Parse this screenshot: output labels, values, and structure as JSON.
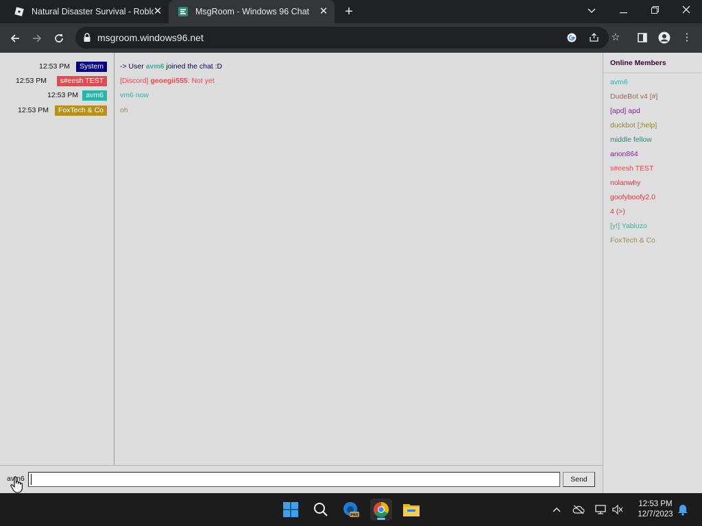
{
  "browser": {
    "tabs": [
      {
        "title": "Natural Disaster Survival - Roblox",
        "icon": "roblox-icon"
      },
      {
        "title": "MsgRoom - Windows 96 Chat",
        "icon": "windows96-icon"
      }
    ],
    "url": "msgroom.windows96.net"
  },
  "chat": {
    "messages": [
      {
        "time": "12:53 PM",
        "user": "System",
        "user_color": "#000080",
        "pre": "-> User ",
        "bold": "avm6",
        "post": " joined the chat :D",
        "text_color": "#000080",
        "bold_color": "#2ab3a8"
      },
      {
        "time": "12:53 PM",
        "user": "s#eesh TEST",
        "user_color": "#e8474e",
        "pre": "[Discord] ",
        "bold": "geoegii555",
        "post": ": Not yet",
        "text_color": "#e8474e",
        "bold_color": "#e8474e"
      },
      {
        "time": "12:53 PM",
        "user": "avm6",
        "user_color": "#2ab3a8",
        "pre": "vm6 now",
        "bold": "",
        "post": "",
        "text_color": "#2ab3a8",
        "bold_color": "#2ab3a8"
      },
      {
        "time": "12:53 PM",
        "user": "FoxTech & Co",
        "user_color": "#b8911c",
        "pre": "oh",
        "bold": "",
        "post": "",
        "text_color": "#a08a3a",
        "bold_color": "#a08a3a"
      }
    ],
    "online_header": "Online Members",
    "members": [
      {
        "name": "avm6",
        "color": "#2ab3a8"
      },
      {
        "name": "DudeBot v4 [#]",
        "color": "#a0635a"
      },
      {
        "name": "[apd] apd",
        "color": "#8a1fa0"
      },
      {
        "name": "duckbot [;help]",
        "color": "#8a8a2a"
      },
      {
        "name": "middle fellow",
        "color": "#2a8a7a"
      },
      {
        "name": "anon864",
        "color": "#8a1fa0"
      },
      {
        "name": "s#eesh TEST",
        "color": "#e8474e"
      },
      {
        "name": "nolanwhy",
        "color": "#d83a40"
      },
      {
        "name": "goofyboofy2.0",
        "color": "#d83a40"
      },
      {
        "name": "4 (>)",
        "color": "#d83a40"
      },
      {
        "name": "[y!] Yabluzo",
        "color": "#3ab0a0"
      },
      {
        "name": "FoxTech & Co",
        "color": "#a08a3a"
      }
    ],
    "nick": "avm6",
    "input_value": "",
    "send_label": "Send"
  },
  "taskbar": {
    "time": "12:53 PM",
    "date": "12/7/2023"
  },
  "colors": {
    "tab_bg": "#202124",
    "active_tab": "#35363a",
    "page_bg": "#dcdcdc"
  }
}
